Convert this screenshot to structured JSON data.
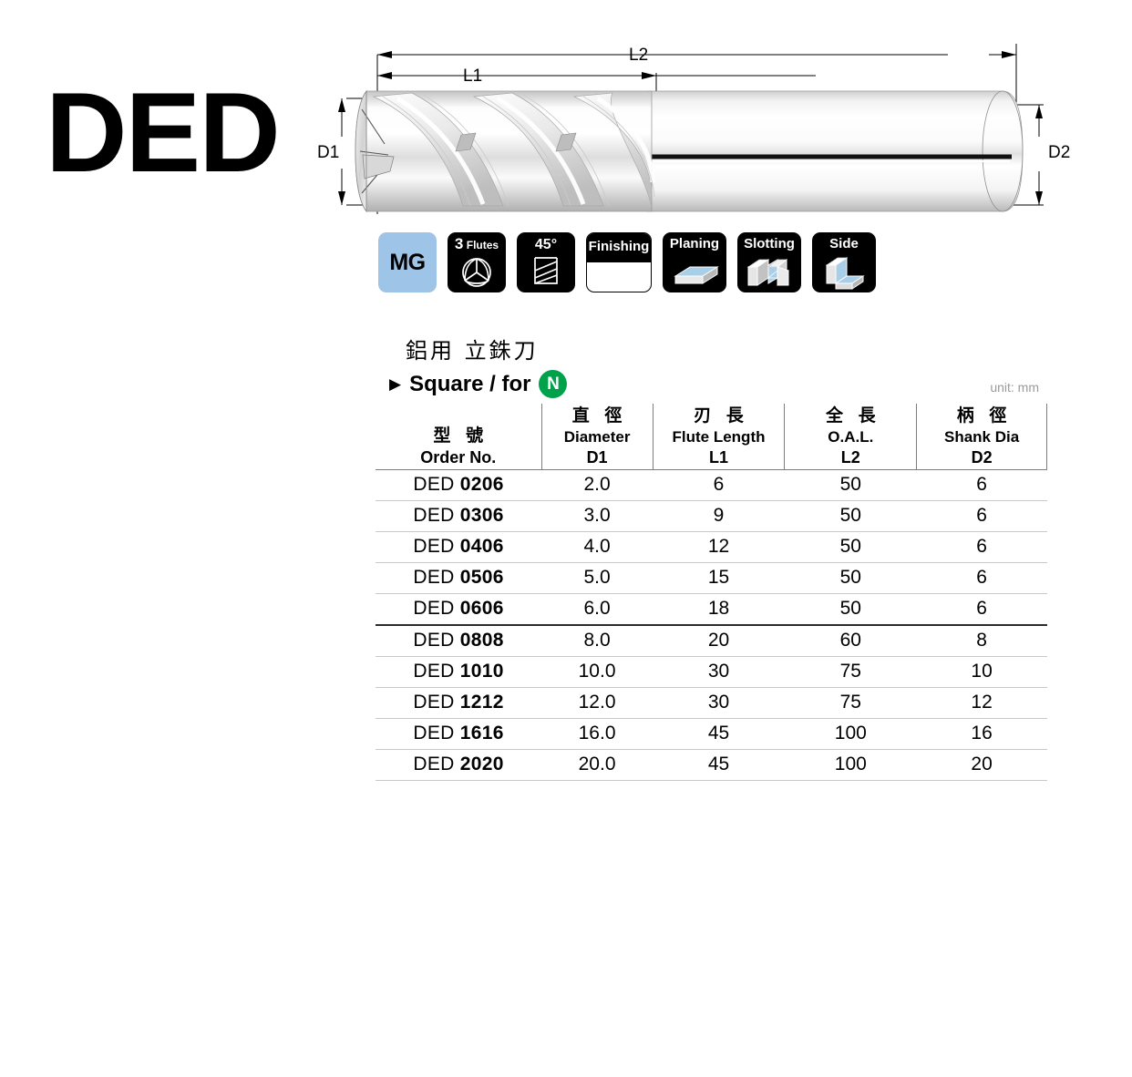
{
  "series": {
    "code": "DED"
  },
  "drawing": {
    "labels": {
      "l1": "L1",
      "l2": "L2",
      "d1": "D1",
      "d2": "D2"
    }
  },
  "badges": [
    {
      "name": "material-group",
      "label": "MG",
      "icon": "mg-badge",
      "style": "blue"
    },
    {
      "name": "flute-count",
      "label_num": "3",
      "label_text": "Flutes",
      "icon": "three-flute-endview-icon",
      "style": "black"
    },
    {
      "name": "helix-angle",
      "label": "45°",
      "icon": "helix-angle-icon",
      "style": "black"
    },
    {
      "name": "finishing",
      "label": "Finishing",
      "icon": "finishing-icon",
      "style": "half"
    },
    {
      "name": "planing",
      "label": "Planing",
      "icon": "planing-workpiece-icon",
      "style": "black"
    },
    {
      "name": "slotting",
      "label": "Slotting",
      "icon": "slotting-workpiece-icon",
      "style": "black"
    },
    {
      "name": "side",
      "label": "Side",
      "icon": "side-milling-workpiece-icon",
      "style": "black"
    }
  ],
  "heading": {
    "chinese": "鋁用  立銖刀",
    "arrow": "▶",
    "english": "Square / for",
    "material_badge": "N",
    "unit_note": "unit: mm"
  },
  "table": {
    "columns": [
      {
        "cn": "型 號",
        "en": "",
        "sym": "Order No."
      },
      {
        "cn": "直 徑",
        "en": "Diameter",
        "sym": "D1"
      },
      {
        "cn": "刃 長",
        "en": "Flute Length",
        "sym": "L1"
      },
      {
        "cn": "全 長",
        "en": "O.A.L.",
        "sym": "L2"
      },
      {
        "cn": "柄 徑",
        "en": "Shank Dia",
        "sym": "D2"
      }
    ],
    "rows": [
      {
        "prefix": "DED ",
        "num": "0206",
        "d1": "2.0",
        "l1": "6",
        "l2": "50",
        "d2": "6"
      },
      {
        "prefix": "DED ",
        "num": "0306",
        "d1": "3.0",
        "l1": "9",
        "l2": "50",
        "d2": "6"
      },
      {
        "prefix": "DED ",
        "num": "0406",
        "d1": "4.0",
        "l1": "12",
        "l2": "50",
        "d2": "6"
      },
      {
        "prefix": "DED ",
        "num": "0506",
        "d1": "5.0",
        "l1": "15",
        "l2": "50",
        "d2": "6"
      },
      {
        "prefix": "DED ",
        "num": "0606",
        "d1": "6.0",
        "l1": "18",
        "l2": "50",
        "d2": "6"
      },
      {
        "prefix": "DED ",
        "num": "0808",
        "d1": "8.0",
        "l1": "20",
        "l2": "60",
        "d2": "8"
      },
      {
        "prefix": "DED ",
        "num": "1010",
        "d1": "10.0",
        "l1": "30",
        "l2": "75",
        "d2": "10"
      },
      {
        "prefix": "DED ",
        "num": "1212",
        "d1": "12.0",
        "l1": "30",
        "l2": "75",
        "d2": "12"
      },
      {
        "prefix": "DED ",
        "num": "1616",
        "d1": "16.0",
        "l1": "45",
        "l2": "100",
        "d2": "16"
      },
      {
        "prefix": "DED ",
        "num": "2020",
        "d1": "20.0",
        "l1": "45",
        "l2": "100",
        "d2": "20"
      }
    ],
    "thick_separator_after_row": 5
  },
  "colors": {
    "mg_badge": "#9ec4e8",
    "material_badge": "#00a14b",
    "badge_black": "#000000",
    "unit_note": "#9a9a9a",
    "workpiece_blue": "#a9cfe8"
  }
}
